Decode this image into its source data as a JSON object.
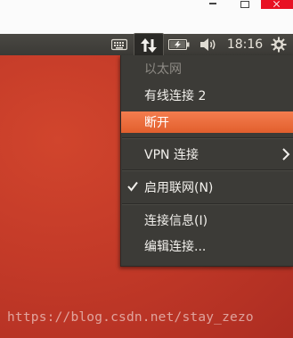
{
  "panel": {
    "clock": "18:16",
    "indicators": [
      "keyboard-icon",
      "network-updown-icon",
      "battery-icon",
      "volume-icon",
      "gear-icon"
    ]
  },
  "network_menu": {
    "items": [
      {
        "label": "以太网",
        "state": "disabled"
      },
      {
        "label": "有线连接 2",
        "state": "normal"
      },
      {
        "label": "断开",
        "state": "highlighted"
      },
      {
        "label": "VPN 连接",
        "state": "submenu"
      },
      {
        "label": "启用联网(N)",
        "state": "checked"
      },
      {
        "label": "连接信息(I)",
        "state": "normal"
      },
      {
        "label": "编辑连接...",
        "state": "normal"
      }
    ]
  },
  "watermark": "https://blog.csdn.net/stay_zezo",
  "colors": {
    "panel": "#3c3b37",
    "menu_bg": "#3c3b37",
    "highlight": "#e95420",
    "desktop": "#c23a28"
  }
}
